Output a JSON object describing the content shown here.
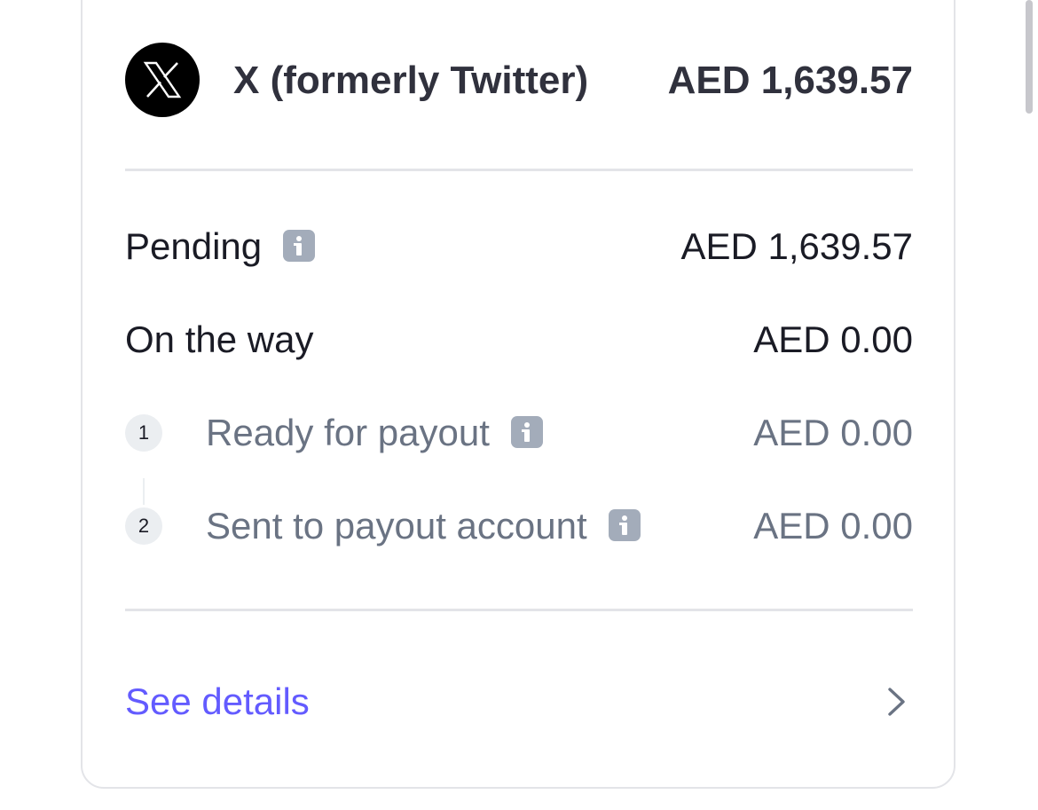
{
  "account": {
    "platform_name": "X (formerly Twitter)",
    "total_amount": "AED 1,639.57",
    "logo_icon": "x-logo-icon"
  },
  "balances": {
    "pending": {
      "label": "Pending",
      "amount": "AED 1,639.57",
      "icon": "info-icon"
    },
    "on_the_way": {
      "label": "On the way",
      "amount": "AED 0.00"
    },
    "steps": [
      {
        "number": "1",
        "label": "Ready for payout",
        "amount": "AED 0.00",
        "icon": "info-icon"
      },
      {
        "number": "2",
        "label": "Sent to payout account",
        "amount": "AED 0.00",
        "icon": "info-icon"
      }
    ]
  },
  "footer": {
    "see_details_label": "See details",
    "chevron_icon": "chevron-right-icon"
  },
  "colors": {
    "link": "#635bff",
    "primary_text": "#1a1b25",
    "muted_text": "#6a7383",
    "divider": "#e3e4e8",
    "info_icon_bg": "#a3acba"
  }
}
